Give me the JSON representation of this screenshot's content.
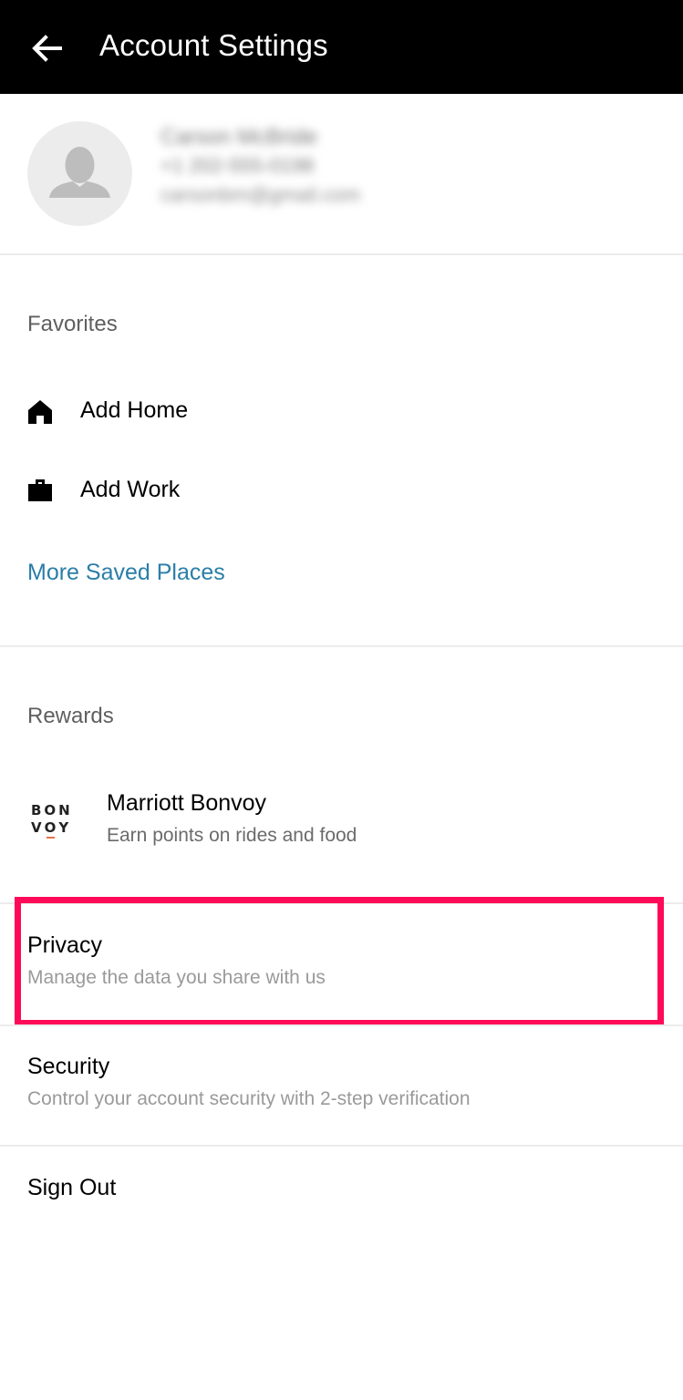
{
  "header": {
    "title": "Account Settings",
    "back_icon": "arrow-left-icon"
  },
  "profile": {
    "avatar_icon": "person-silhouette-icon",
    "name": "Carson McBride",
    "phone": "+1 202-555-0198",
    "email": "carsonbm@gmail.com"
  },
  "favorites": {
    "label": "Favorites",
    "items": [
      {
        "label": "Add Home",
        "icon": "home-icon"
      },
      {
        "label": "Add Work",
        "icon": "briefcase-icon"
      }
    ],
    "more_link": "More Saved Places"
  },
  "rewards": {
    "label": "Rewards",
    "logo_lines": [
      "BON",
      "VOY"
    ],
    "title": "Marriott Bonvoy",
    "subtitle": "Earn points on rides and food"
  },
  "privacy": {
    "title": "Privacy",
    "subtitle": "Manage the data you share with us"
  },
  "security": {
    "title": "Security",
    "subtitle": "Control your account security with 2-step verification"
  },
  "sign_out": {
    "label": "Sign Out"
  },
  "colors": {
    "header_bg": "#000000",
    "link": "#2a7ea8",
    "highlight": "#ff0a58"
  }
}
